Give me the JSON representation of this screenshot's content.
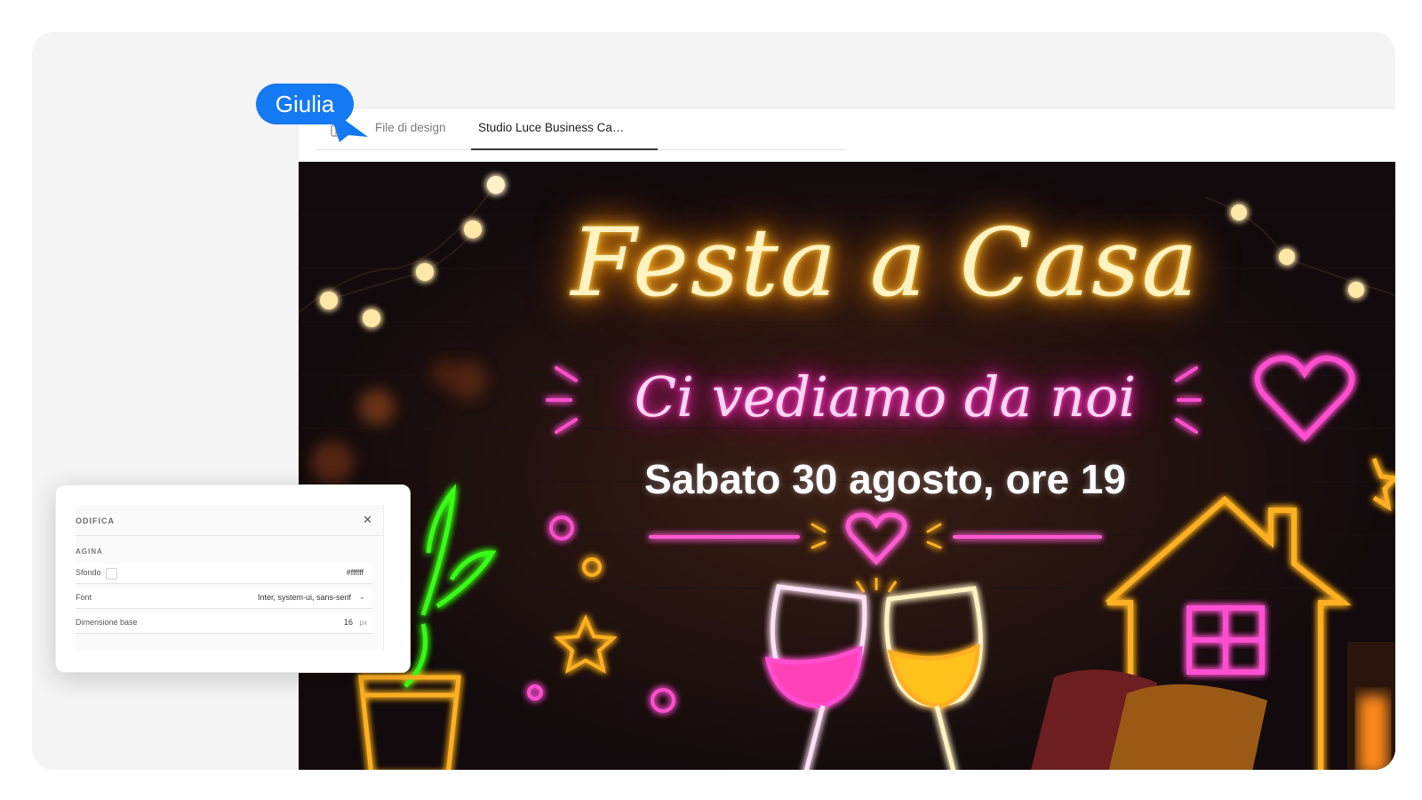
{
  "collaborator": {
    "name": "Giulia",
    "color": "#1479f2"
  },
  "tabs": [
    {
      "label": "File di design",
      "active": false
    },
    {
      "label": "Studio Luce Business Ca…",
      "active": true
    }
  ],
  "design": {
    "title": "Festa a Casa",
    "subtitle": "Ci vediamo da noi",
    "date_line": "Sabato 30 agosto, ore 19",
    "colors": {
      "title_glow": "#ffb020",
      "subtitle_glow": "#ff2fb8",
      "plant_glow": "#39ff14",
      "background": "#120a0c"
    }
  },
  "edit_panel": {
    "title": "ODIFICA",
    "close_icon": "close-icon",
    "section_title": "AGINA",
    "fields": [
      {
        "label": "Sfondo",
        "value": "#ffffff"
      },
      {
        "label": "Font",
        "value": "Inter, system-ui, sans-serif"
      },
      {
        "label": "Dimensione base",
        "value": "16",
        "unit": "px"
      }
    ]
  }
}
